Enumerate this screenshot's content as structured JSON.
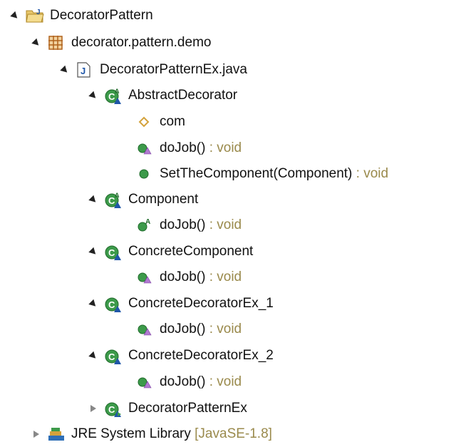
{
  "colors": {
    "type_suffix": "#9a8a4c",
    "class_green": "#2f8a3a",
    "interface_blue": "#1f56a8"
  },
  "tree": {
    "project": {
      "label": "DecoratorPattern",
      "icon": "java-project-icon"
    },
    "package": {
      "label": "decorator.pattern.demo",
      "icon": "package-icon"
    },
    "file": {
      "label": "DecoratorPatternEx.java",
      "icon": "java-file-icon"
    },
    "nodes": [
      {
        "label": "AbstractDecorator",
        "suffix": "",
        "icon": "abstract-class-icon"
      },
      {
        "label": "com",
        "suffix": "",
        "icon": "protected-field-icon"
      },
      {
        "label": "doJob()",
        "suffix": " : void",
        "icon": "override-method-icon"
      },
      {
        "label": "SetTheComponent(Component)",
        "suffix": " : void",
        "icon": "public-method-icon"
      },
      {
        "label": "Component",
        "suffix": "",
        "icon": "abstract-class-icon"
      },
      {
        "label": "doJob()",
        "suffix": " : void",
        "icon": "abstract-method-icon"
      },
      {
        "label": "ConcreteComponent",
        "suffix": "",
        "icon": "class-icon"
      },
      {
        "label": "doJob()",
        "suffix": " : void",
        "icon": "override-method-icon"
      },
      {
        "label": "ConcreteDecoratorEx_1",
        "suffix": "",
        "icon": "class-icon"
      },
      {
        "label": "doJob()",
        "suffix": " : void",
        "icon": "override-method-icon"
      },
      {
        "label": "ConcreteDecoratorEx_2",
        "suffix": "",
        "icon": "class-icon"
      },
      {
        "label": "doJob()",
        "suffix": " : void",
        "icon": "override-method-icon"
      },
      {
        "label": "DecoratorPatternEx",
        "suffix": "",
        "icon": "main-class-icon"
      }
    ],
    "library": {
      "label": "JRE System Library",
      "suffix": " [JavaSE-1.8]",
      "icon": "library-icon"
    }
  }
}
